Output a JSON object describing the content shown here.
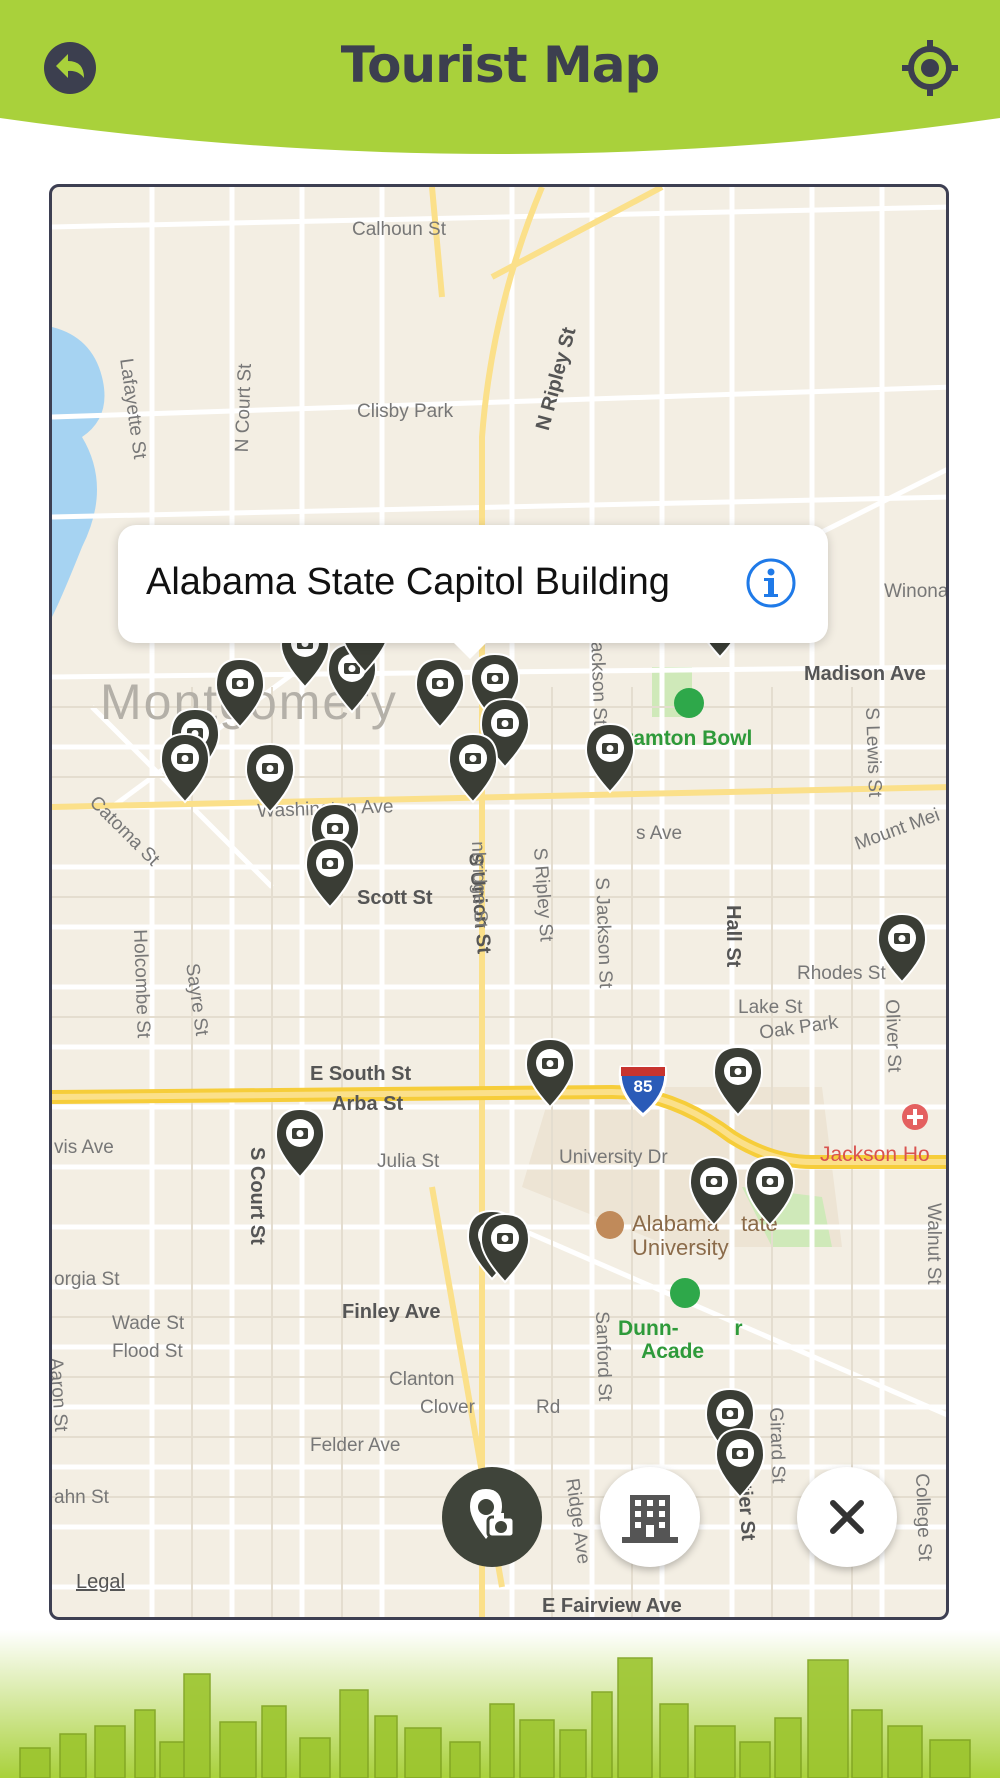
{
  "header": {
    "title": "Tourist Map",
    "back_icon": "back-arrow-icon",
    "locate_icon": "crosshair-locate-icon",
    "accent": "#a9d13b"
  },
  "callout": {
    "title": "Alabama State Capitol Building",
    "info_icon": "info-icon"
  },
  "map": {
    "city_label": "Montgomery",
    "legal": "Legal",
    "streets": [
      "Calhoun St",
      "Clisby Park",
      "N Ripley St",
      "Lafayette St",
      "N Court St",
      "Winona",
      "Madison Ave",
      "Washington Ave",
      "Scott St",
      "Catoma St",
      "Holcombe St",
      "Sayre St",
      "S Union St",
      "S Ripley St",
      "S Jackson St",
      "Hall St",
      "S Lewis St",
      "Mount Mei",
      "Rhodes St",
      "Lake St",
      "Oak Park",
      "E South St",
      "Arba St",
      "Julia St",
      "University Dr",
      "S Court St",
      "Finley Ave",
      "Wade St",
      "Flood St",
      "Clanton",
      "Clover",
      "Rd",
      "Felder Ave",
      "Sanford St",
      "Ridge Ave",
      "Girard St",
      "Boultier St",
      "College St",
      "Walnut St",
      "E Fairview Ave",
      "vis Ave",
      "orgia St",
      "ahn St",
      "Aaron St",
      "Oliver St",
      "Jackson St",
      "nbridge St",
      "s Ave"
    ],
    "pois": {
      "cramton_bowl": "Cramton Bowl",
      "alabama_state_university": "Alabama State University",
      "asu_line1": "Alabama",
      "asu_line2": "tate",
      "asu_line3": "University",
      "dunn_line1": "Dunn-",
      "dunn_line2": "r",
      "dunn_line3": "Acade",
      "hospital": "Jackson Ho",
      "interstate": "85"
    }
  },
  "controls": {
    "camera_icon": "camera-pin-icon",
    "building_icon": "building-icon",
    "close_icon": "close-icon"
  }
}
